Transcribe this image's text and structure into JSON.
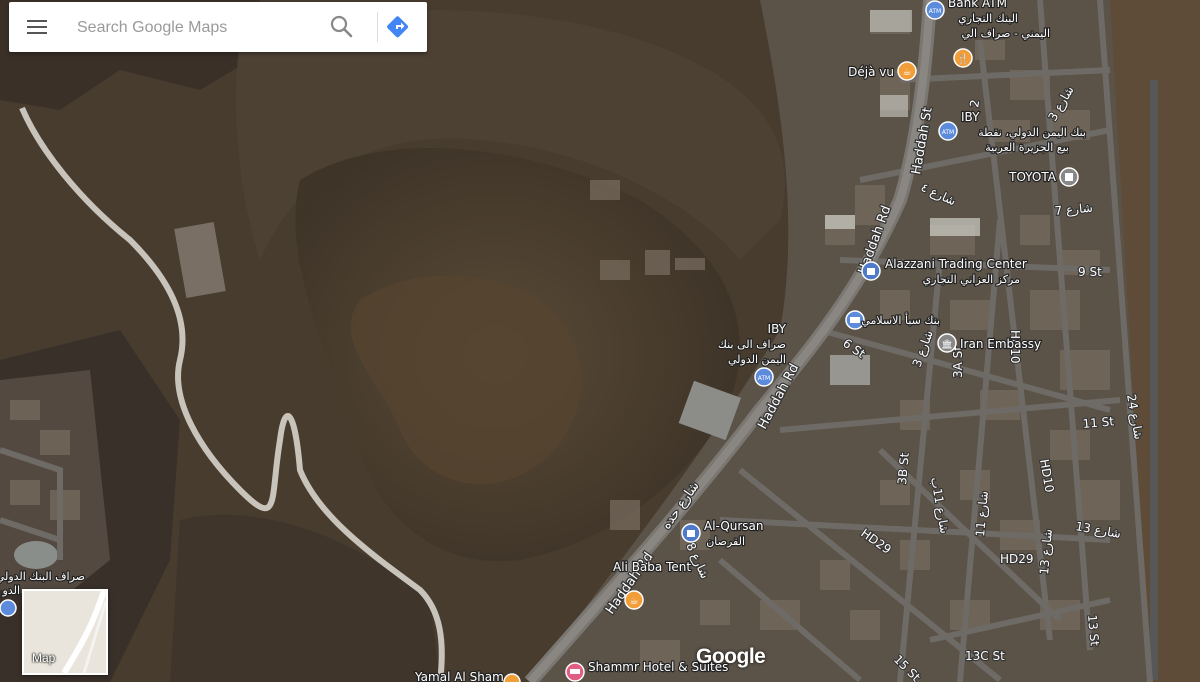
{
  "search": {
    "placeholder": "Search Google Maps"
  },
  "icons": {
    "menu": "hamburger-menu-icon",
    "search": "search-icon",
    "directions": "directions-icon"
  },
  "colors": {
    "directions_blue": "#4285f4",
    "atm_blue": "#5c8bdc",
    "cafe_orange": "#f29d38",
    "food_orange": "#f29d38",
    "shopping_blue": "#4f7ac9",
    "lodging_pink": "#e15d82",
    "embassy_grey": "#888888"
  },
  "places": {
    "bank_atm_top": "Bank ATM",
    "bank_top_ar1": "البنك التجاري",
    "bank_top_ar2": "اليمني - صراف الي",
    "dejavu": "Déjà vu",
    "iby_top": "IBY",
    "iby_top_ar1": "بنك اليمن الدولي، نقطة",
    "iby_top_ar2": "بيع الجزيرة العربية",
    "toyota": "TOYOTA",
    "alazzani": "Alazzani Trading Center",
    "alazzani_ar": "مركز العزاني التجاري",
    "saba_bank_ar": "بنك سبأ الاسلامي",
    "iran_embassy": "Iran Embassy",
    "iby_mid": "IBY",
    "iby_mid_ar1": "صراف الى بنك",
    "iby_mid_ar2": "اليمن الدولي",
    "alqursan": "Al-Qursan",
    "alqursan_ar": "القرصان",
    "ali_baba": "Ali Baba Tent",
    "shammr": "Shammr Hotel & Suites",
    "yamal": "Yamal Al Sham",
    "left_bank_ar": "صراف البنك الدولي",
    "left_bank_ar2": "الدو"
  },
  "roads": {
    "haddah_st": "Haddah St",
    "haddah_rd_upper": "Haddah Rd",
    "haddah_rd_mid": "Haddah Rd",
    "haddah_rd_lower": "Haddah Rd",
    "haddah_ar": "شارع حده",
    "st4_ar": "شارع ٤",
    "st7_ar": "شارع 7",
    "st9": "9 St",
    "st6": "6 St",
    "st3_ar": "شارع 3",
    "st3_top_ar": "شارع 3",
    "st3a": "3A St",
    "hd10_top": "HD10",
    "hd10_mid": "HD10",
    "st11": "11 St",
    "st24_ar": "شارع 24",
    "st3b": "3B St",
    "st11b_ar": "شارع 11ب",
    "st13_ar": "شارع 13",
    "hd29_a": "HD29",
    "hd29_b": "HD29",
    "st11_ar": "شارع 11",
    "st8_ar": "شارع 8",
    "st13_vert_ar": "شارع 13",
    "st13_low": "13 St",
    "st13c": "13C St",
    "st15": "15 St",
    "st2": "2"
  },
  "minimap": {
    "label": "Map"
  },
  "logo": {
    "text": "Google"
  }
}
